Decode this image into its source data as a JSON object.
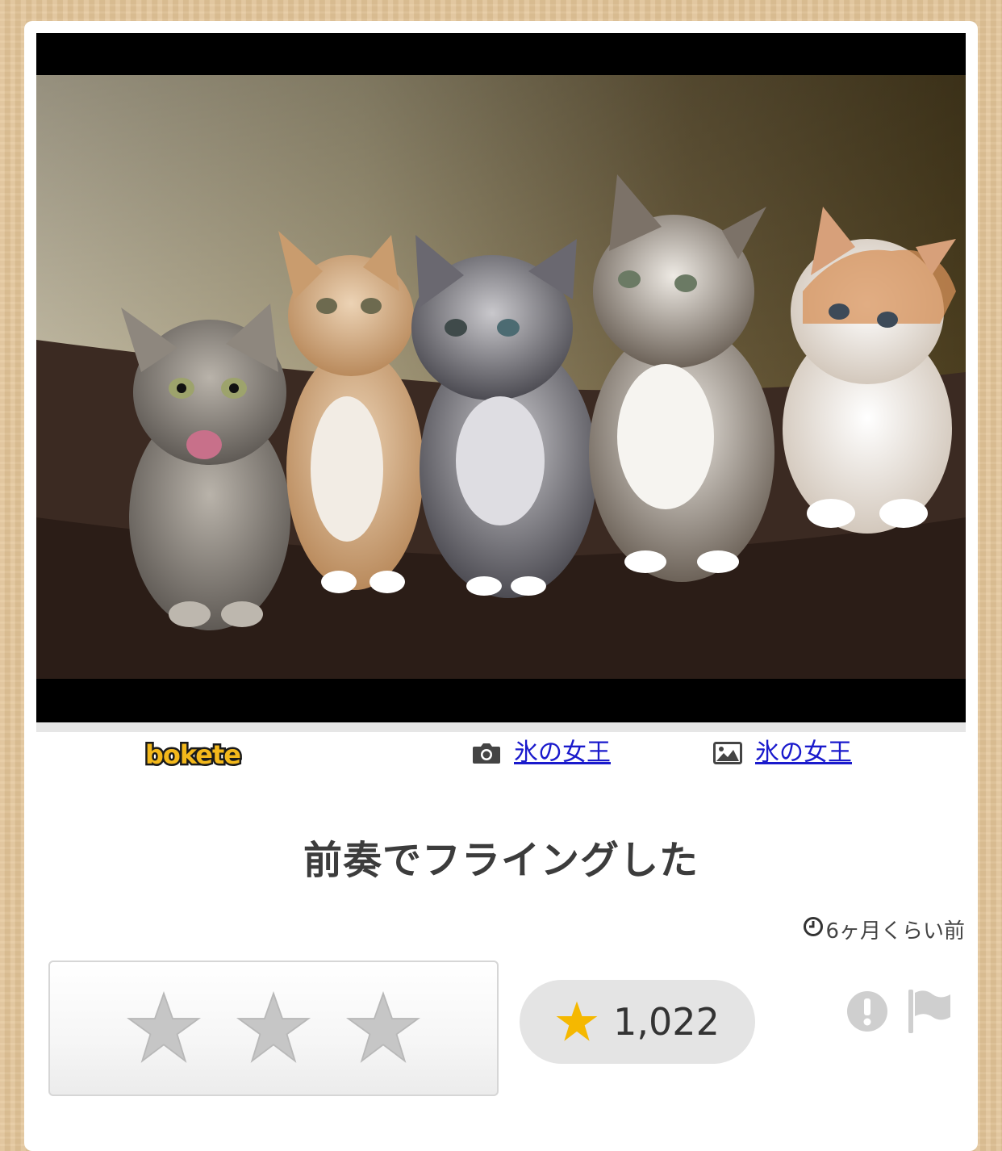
{
  "post": {
    "photo_alt": "kittens",
    "logo_text": "bokete",
    "photographer": "氷の女王",
    "image_author": "氷の女王",
    "caption": "前奏でフライングした",
    "posted_ago": "6ヶ月くらい前"
  },
  "rating": {
    "stars_total": 3,
    "star_count": "1,022"
  },
  "colors": {
    "link": "#1a1acc",
    "star_gold": "#f5b800",
    "logo_yellow": "#f3b81b"
  },
  "icons": {
    "camera": "camera-icon",
    "image": "image-icon",
    "clock": "clock-icon",
    "star": "star-icon",
    "report": "exclamation-icon",
    "flag": "flag-icon"
  }
}
